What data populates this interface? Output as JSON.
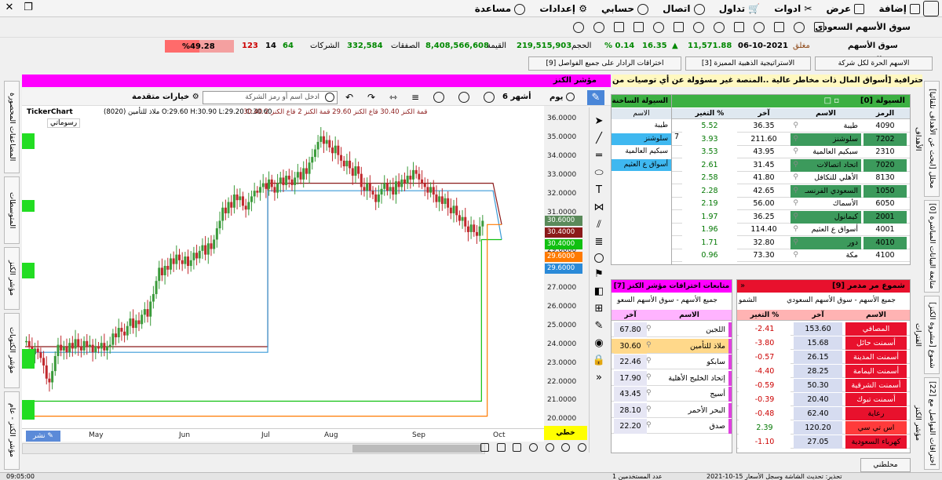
{
  "menu": {
    "items": [
      "إضافة",
      "عرض",
      "ادوات",
      "تداول",
      "اتصال",
      "حسابي",
      "إعدادات",
      "مساعدة"
    ]
  },
  "stats": {
    "market": "سوق الأسهم السعودي",
    "status": "مغلق",
    "date": "06-10-2021",
    "index": "11,571.88",
    "change": "16.35",
    "change_pct": "% 0.14",
    "volume_label": "الحجم",
    "volume": "219,515,903",
    "value_label": "القيمة",
    "value": "8,408,566,608",
    "trades_label": "الصفقات",
    "trades": "332,584",
    "companies_label": "الشركات",
    "up": "64",
    "unch": "14",
    "down": "123",
    "pct": "%49.28"
  },
  "tabs": [
    "الاسهم الحرة لكل شركة",
    "الاستراتيجية الذهبية المميزة [3]",
    "اختراقات الرادار على جميع الفواصل [9]"
  ],
  "banner": "منصة الكنز الإحترافية [أسواق المال ذات مخاطر عالية ..المنصة غير مسؤولة عن أي توصيات من",
  "indicator_title": "مؤشر الكنز",
  "toolbar": {
    "period": "يوم",
    "months": "6 أشهر",
    "search_placeholder": "ادخل اسم أو رمز الشركة",
    "advanced": "خيارات متقدمة"
  },
  "chart_info": {
    "brand": "TickerChart",
    "line1": "ملاذ للتأمين (8020) O:29.60 H:30.90 L:29.20 C:30.60",
    "legend": "30.40 قمة الكنز  30.40 قاع الكنز  29.60 قمة الكنز 2  قاع الكنز 2",
    "drawings": "رسوماتي"
  },
  "chart_data": {
    "type": "candlestick",
    "x_labels": [
      "May",
      "Jun",
      "Jul",
      "Aug",
      "Sep",
      "Oct"
    ],
    "ylim": [
      19.6,
      36.3
    ],
    "y_ticks": [
      "36.0000",
      "35.0000",
      "34.0000",
      "33.0000",
      "32.0000",
      "31.0000",
      "30.0000",
      "29.0000",
      "28.0000",
      "27.0000",
      "26.0000",
      "25.0000",
      "24.0000",
      "23.0000",
      "22.0000",
      "21.0000",
      "20.0000"
    ],
    "price_tags": [
      {
        "v": "30.6000",
        "c": "#5a8a5a"
      },
      {
        "v": "30.4000",
        "c": "#8b1a1a"
      },
      {
        "v": "30.4000",
        "c": "#10c010"
      },
      {
        "v": "29.6000",
        "c": "#ff7a00"
      },
      {
        "v": "29.6000",
        "c": "#2a8ad8"
      }
    ],
    "closes": [
      24.2,
      23.9,
      23.5,
      23.8,
      23.6,
      23.3,
      22.9,
      22.2,
      22.0,
      22.6,
      23.4,
      24.0,
      23.7,
      23.9,
      23.6,
      24.1,
      23.8,
      24.3,
      23.9,
      23.7,
      24.2,
      23.9,
      24.0,
      23.6,
      23.9,
      23.8,
      24.1,
      23.7,
      23.9,
      24.0,
      24.6,
      24.4,
      24.9,
      24.7,
      24.5,
      25.0,
      25.4,
      24.9,
      25.3,
      25.1,
      25.6,
      25.9,
      25.5,
      26.3,
      26.7,
      27.4,
      28.1,
      27.7,
      28.2,
      28.0,
      28.6,
      28.3,
      28.8,
      28.5,
      28.3,
      28.7,
      28.2,
      28.5,
      28.9,
      28.6,
      29.0,
      29.3,
      28.8,
      29.4,
      29.1,
      29.6,
      30.2,
      30.6,
      31.3,
      31.0,
      31.6,
      31.3,
      32.0,
      31.7,
      31.9,
      31.4,
      31.2,
      31.6,
      31.9,
      32.2,
      32.1,
      32.4,
      32.6,
      32.3,
      32.8,
      32.4,
      32.1,
      32.6,
      32.9,
      32.5,
      33.0,
      32.8,
      32.5,
      32.9,
      33.2,
      32.8,
      33.4,
      33.1,
      33.7,
      34.0,
      34.4,
      34.8,
      35.1,
      34.7,
      34.9,
      34.5,
      34.2,
      34.6,
      34.1,
      33.8,
      33.5,
      33.8,
      33.4,
      33.0,
      33.5,
      33.1,
      32.4,
      32.2,
      32.6,
      32.2,
      32.0,
      31.6,
      32.0,
      32.3,
      32.6,
      32.2,
      32.4,
      32.0,
      32.7,
      32.4,
      32.8,
      32.6,
      33.0,
      32.8,
      33.3,
      33.1,
      32.8,
      32.6,
      32.4,
      32.1,
      32.4,
      32.0,
      31.6,
      31.9,
      31.5,
      31.8,
      31.3,
      31.0,
      31.4,
      30.9,
      30.6,
      30.8,
      30.3,
      30.0,
      30.4,
      30.0,
      29.8,
      30.3,
      30.6
    ],
    "series": [
      {
        "name": "قمة الكنز",
        "color": "#8b1a1a",
        "points": [
          [
            0,
            23.9
          ],
          [
            84,
            23.9
          ],
          [
            84,
            32.6
          ],
          [
            162,
            32.6
          ],
          [
            165,
            30.4
          ]
        ]
      },
      {
        "name": "قمة الكنز 2",
        "color": "#3a9ad8",
        "points": [
          [
            0,
            23.6
          ],
          [
            84,
            23.6
          ],
          [
            84,
            32.2
          ],
          [
            162,
            32.2
          ],
          [
            165,
            29.6
          ]
        ]
      },
      {
        "name": "قاع الكنز",
        "color": "#10c010",
        "points": [
          [
            0,
            21.0
          ],
          [
            158,
            21.0
          ],
          [
            158,
            29.6
          ],
          [
            165,
            29.6
          ]
        ]
      },
      {
        "name": "قاع الكنز 2",
        "color": "#ff7a00",
        "points": [
          [
            0,
            20.2
          ],
          [
            160,
            20.2
          ],
          [
            160,
            30.4
          ],
          [
            165,
            30.4
          ]
        ]
      }
    ]
  },
  "tool_btn": "خطي",
  "publish_btn": "نشر",
  "panels": {
    "gainers_title": "السيولة [0]",
    "gainers_headers": [
      "الرمز",
      "الاسم",
      "آخر",
      "التغير %"
    ],
    "gainers": [
      [
        "4090",
        "طيبة",
        "36.35",
        "5.52"
      ],
      [
        "7202",
        "سلوشنز",
        "211.60",
        "3.93"
      ],
      [
        "2310",
        "سبكيم العالمية",
        "43.95",
        "3.53"
      ],
      [
        "7020",
        "اتحاد اتصالات",
        "31.45",
        "2.61"
      ],
      [
        "8130",
        "الأهلي للتكافل",
        "41.80",
        "2.58"
      ],
      [
        "1050",
        "السعودي الفرنسـ",
        "42.65",
        "2.28"
      ],
      [
        "6050",
        "الأسماك",
        "56.00",
        "2.19"
      ],
      [
        "2001",
        "كيمانول",
        "36.25",
        "1.97"
      ],
      [
        "4001",
        "أسواق ع العثيم",
        "114.40",
        "1.96"
      ],
      [
        "4010",
        "دور",
        "32.80",
        "1.71"
      ],
      [
        "4100",
        "مكة",
        "73.30",
        "0.96"
      ]
    ],
    "liquidity_title": "السيولة الساخنة",
    "liquidity_header": "الاسم",
    "liquidity": [
      "طيبة",
      "سلوشنز",
      "سبكيم العالمية",
      "أسواق ع العثيم"
    ],
    "partial": "7",
    "losers_title": "شموع مر مدمر [9]",
    "filter": "جميع الأسهم - سوق الأسهم السعودي",
    "filter_label": "الشمو",
    "losers_headers": [
      "الاسم",
      "آخر",
      "التغير %"
    ],
    "losers": [
      [
        "المصافي",
        "153.60",
        "-2.41"
      ],
      [
        "أسمنت حائل",
        "15.68",
        "-3.80"
      ],
      [
        "أسمنت المدينة",
        "26.15",
        "-0.57"
      ],
      [
        "أسمنت اليمامة",
        "28.25",
        "-4.40"
      ],
      [
        "أسمنت الشرقية",
        "50.30",
        "-0.59"
      ],
      [
        "أسمنت تبوك",
        "20.40",
        "-0.39"
      ],
      [
        "رعاية",
        "62.40",
        "-0.48"
      ],
      [
        "اس تي سي",
        "120.20",
        "2.39"
      ],
      [
        "كهرباء السعودية",
        "27.05",
        "-1.10"
      ]
    ],
    "breakouts_title": "متابعات اختراقات مؤشر الكنز [7]",
    "breakouts_filter": "جميع الأسهم - سوق الأسهم السعو",
    "breakouts_headers": [
      "الاسم",
      "آخر"
    ],
    "breakouts": [
      [
        "اللجين",
        "67.80"
      ],
      [
        "ملاذ للتأمين",
        "30.60"
      ],
      [
        "سابكو",
        "22.46"
      ],
      [
        "إتحاد الخليج الأهلية",
        "17.90"
      ],
      [
        "أسيج",
        "43.45"
      ],
      [
        "البحر الأحمر",
        "28.10"
      ],
      [
        "صدق",
        "22.20"
      ]
    ],
    "bottom_btn": "محلطني"
  },
  "vtabs_left": [
    "المضاعفات المحصورة",
    "المتوسطات",
    "مؤشر الكنز",
    "مؤشر الكتوبات",
    "مؤشر الكنز - عام"
  ],
  "vtabs_right": [
    "[ابحث عن الأهداف تلقائيا] محلل الأهداف",
    "متابعة البيانات المباشرة [0]",
    "[مشروة الكنز] شموع الفترات",
    "[22] اختراقات الفواصل مع مؤشر الكنز"
  ],
  "status": {
    "time": "09:05:00",
    "text": "تحذير: تحديث الشاشة وسجل الأسعار 15-10-2021",
    "extra": "عدد المستخدمين 1"
  }
}
